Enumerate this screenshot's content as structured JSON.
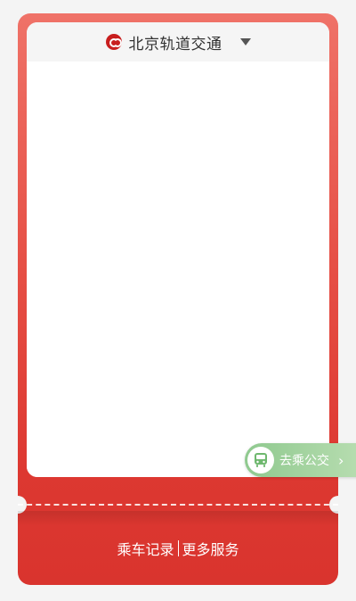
{
  "header": {
    "operator_name": "北京轨道交通",
    "logo_icon": "beijing-subway-logo",
    "dropdown_icon": "caret-down-icon"
  },
  "bottom": {
    "ride_records": "乘车记录",
    "separator": "|",
    "more_services": "更多服务"
  },
  "bus_pill": {
    "label": "去乘公交",
    "icon": "bus-icon",
    "chevron": "›"
  },
  "colors": {
    "ticket_red_top": "#ef7268",
    "ticket_red_bottom": "#d9342e",
    "bus_green": "#8fc98f",
    "page_bg": "#f4f4f4"
  }
}
